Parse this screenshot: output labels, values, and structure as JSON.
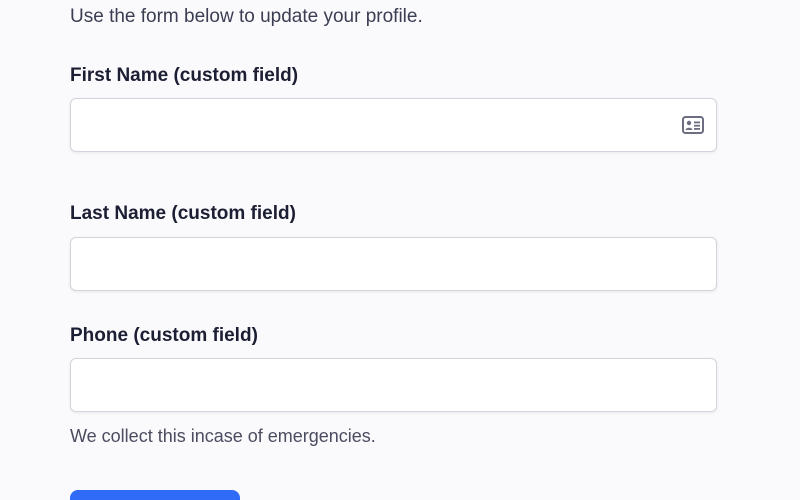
{
  "intro_text": "Use the form below to update your profile.",
  "fields": [
    {
      "label": "First Name (custom field)",
      "value": "",
      "placeholder": "",
      "icon": "contact-card-icon"
    },
    {
      "label": "Last Name (custom field)",
      "value": "",
      "placeholder": ""
    },
    {
      "label": "Phone (custom field)",
      "value": "",
      "placeholder": "",
      "help_text": "We collect this incase of emergencies."
    }
  ],
  "colors": {
    "background": "#fafafc",
    "text": "#1c1e33",
    "input_border": "#d3d5de",
    "primary_button": "#2f6bf6"
  }
}
